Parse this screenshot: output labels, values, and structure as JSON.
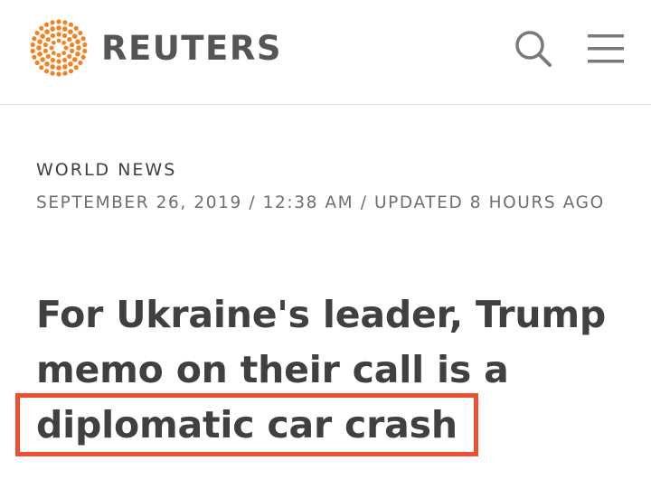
{
  "header": {
    "brand_name": "REUTERS",
    "logo_icon": "reuters-dot-logo-icon",
    "search_icon": "search-icon",
    "menu_icon": "hamburger-menu-icon",
    "brand_color": "#f58220"
  },
  "article": {
    "section": "WORLD NEWS",
    "dateline": "SEPTEMBER 26, 2019 / 12:38 AM / UPDATED 8 HOURS AGO",
    "headline": "For Ukraine's leader, Trump memo on their call is a diplomatic car crash"
  },
  "annotation": {
    "highlight_color": "#f04e30"
  }
}
